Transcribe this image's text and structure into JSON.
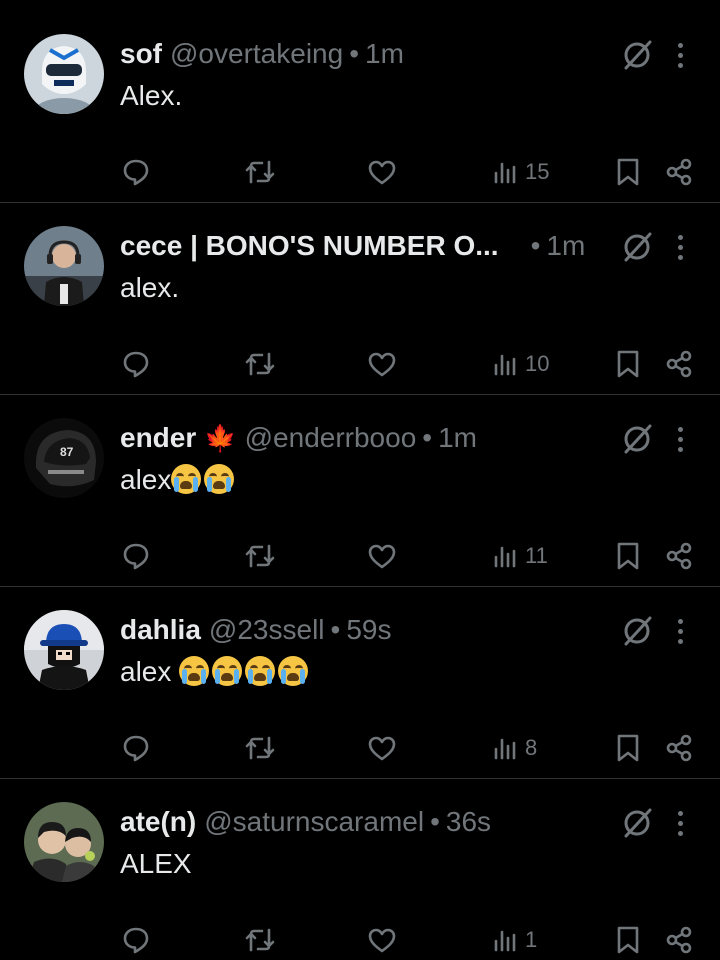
{
  "posts": [
    {
      "name": "sof",
      "handle": "@overtakeing",
      "dot": "•",
      "time": "1m",
      "text": "Alex.",
      "emoji_count": 0,
      "views": "15",
      "avatar": "helmet-avatar"
    },
    {
      "name": "cece | BONO'S NUMBER O...",
      "handle": "",
      "dot": "•",
      "time": "1m",
      "text": "alex.",
      "emoji_count": 0,
      "views": "10",
      "avatar": "person-avatar"
    },
    {
      "name": "ender",
      "name_emoji": "🍁",
      "handle": "@enderrbooo",
      "dot": "•",
      "time": "1m",
      "text": "alex",
      "emoji_count": 2,
      "views": "11",
      "avatar": "helmet-87-avatar"
    },
    {
      "name": "dahlia",
      "handle": "@23ssell",
      "dot": "•",
      "time": "59s",
      "text": "alex ",
      "emoji_count": 4,
      "views": "8",
      "avatar": "cap-person-avatar"
    },
    {
      "name": "ate(n)",
      "handle": "@saturnscaramel",
      "dot": "•",
      "time": "36s",
      "text": "ALEX",
      "emoji_count": 0,
      "views": "1",
      "avatar": "two-people-avatar"
    }
  ],
  "icons": {
    "reply": "reply-icon",
    "repost": "repost-icon",
    "like": "heart-icon",
    "views": "views-icon",
    "bookmark": "bookmark-icon",
    "share": "share-icon",
    "grok": "grok-icon",
    "more": "more-icon",
    "loudly_crying": "loudly-crying-face-emoji"
  },
  "colors": {
    "background": "#000000",
    "text": "#e7e9ea",
    "muted": "#71767b",
    "divider": "#2f3336"
  }
}
